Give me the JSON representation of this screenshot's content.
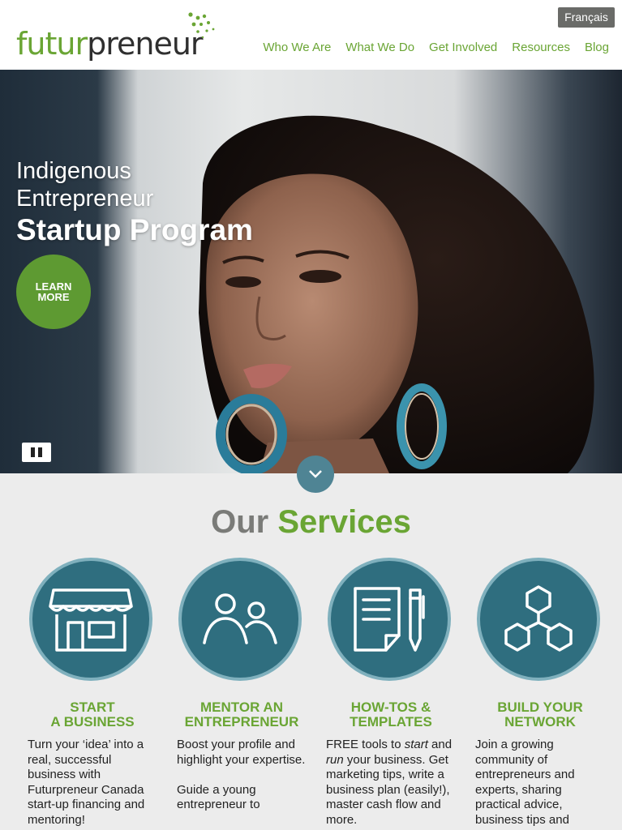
{
  "brand": {
    "logo_green": "futur",
    "logo_dark": "preneur",
    "green": "#6aa534",
    "teal": "#2f6e7f"
  },
  "header": {
    "language_toggle": "Français",
    "nav": [
      "Who We Are",
      "What We Do",
      "Get Involved",
      "Resources",
      "Blog"
    ]
  },
  "hero": {
    "line1": "Indigenous",
    "line2": "Entrepreneur",
    "line3": "Startup Program",
    "cta_line1": "LEARN",
    "cta_line2": "MORE"
  },
  "services": {
    "title_part1": "Our",
    "title_part2": "Services",
    "items": [
      {
        "icon": "storefront-icon",
        "title1": "START",
        "title2": "A BUSINESS",
        "desc": "Turn your ‘idea’ into a real, successful business with Futurpreneur Canada start-up financing and mentoring!"
      },
      {
        "icon": "people-icon",
        "title1": "MENTOR AN",
        "title2": "ENTREPRENEUR",
        "desc": "Boost your profile and highlight your expertise.",
        "desc2": "Guide a young entrepreneur to"
      },
      {
        "icon": "document-pen-icon",
        "title1": "HOW-TOS &",
        "title2": "TEMPLATES",
        "desc_a": "FREE tools to ",
        "desc_b": "start",
        "desc_c": " and ",
        "desc_d": "run",
        "desc_e": " your business. Get marketing tips, write a business plan (easily!), master cash flow and more."
      },
      {
        "icon": "network-hexagons-icon",
        "title1": "BUILD YOUR",
        "title2": "NETWORK",
        "desc": "Join a growing community of entrepreneurs and experts, sharing practical advice, business tips and"
      }
    ]
  }
}
